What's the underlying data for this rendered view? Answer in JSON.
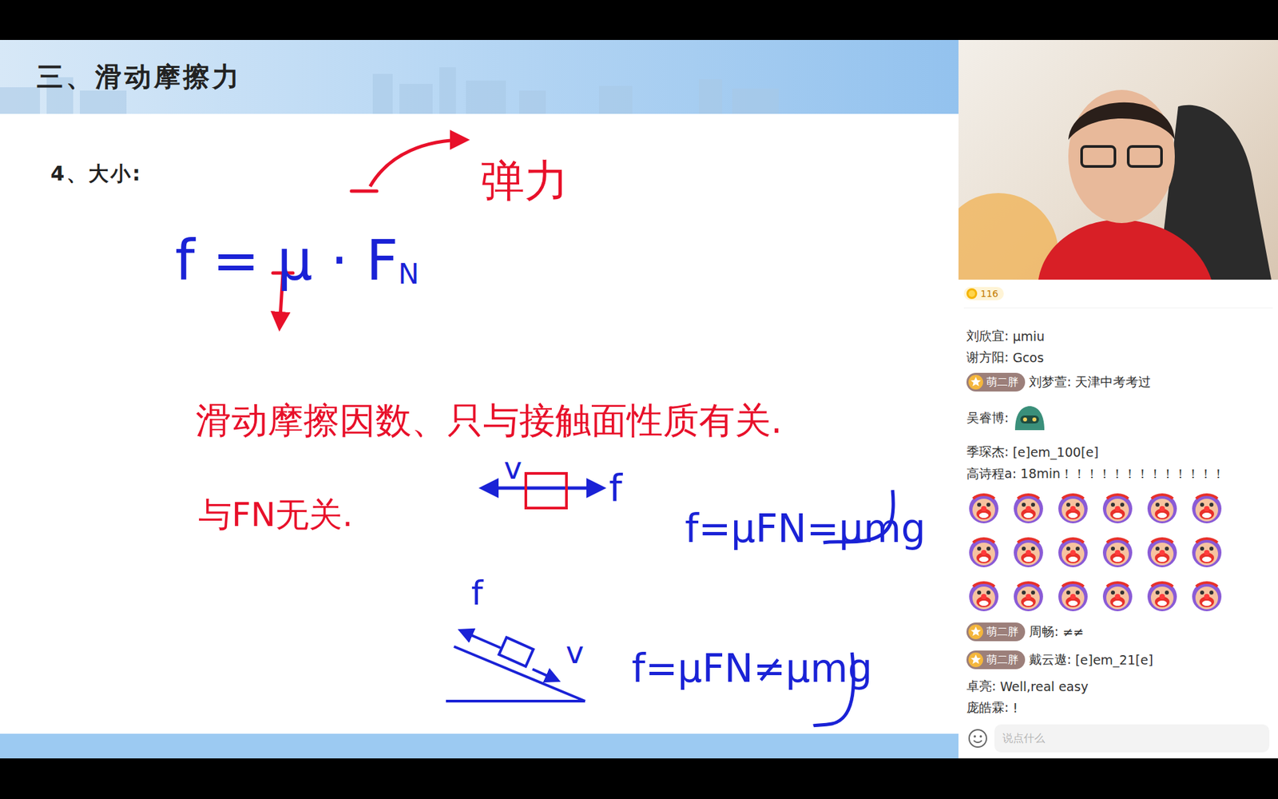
{
  "slide": {
    "title": "三、滑动摩擦力",
    "section": "4、大小:",
    "annotations": [
      {
        "text": "弹力",
        "color": "#e8102a"
      },
      {
        "text": "f = μ · F",
        "sub": "N",
        "color": "#1a22d6"
      },
      {
        "text": "滑动摩擦因数、只与接触面性质有关.",
        "color": "#e8102a"
      },
      {
        "text": "与FN无关.",
        "color": "#e8102a"
      },
      {
        "text": "v",
        "color": "#1a22d6"
      },
      {
        "text": "f",
        "color": "#1a22d6"
      },
      {
        "text": "f=μFN=μmg",
        "color": "#1a22d6"
      },
      {
        "text": "f",
        "color": "#1a22d6"
      },
      {
        "text": "v",
        "color": "#1a22d6"
      },
      {
        "text": "f=μFN≠μmg",
        "color": "#1a22d6"
      }
    ]
  },
  "coins": "116",
  "chat": {
    "messages": [
      {
        "kind": "text",
        "name": "刘欣宜:",
        "text": "μmiu"
      },
      {
        "kind": "text",
        "name": "谢方阳:",
        "text": "Gcos"
      },
      {
        "kind": "text",
        "badge": "萌二胖",
        "name": "刘梦萱:",
        "text": "天津中考考过"
      },
      {
        "kind": "sticker",
        "name": "吴睿博:"
      },
      {
        "kind": "text",
        "name": "季琛杰:",
        "text": "[e]em_100[e]"
      },
      {
        "kind": "text",
        "name": "高诗程a:",
        "text": "18min！！！！！！！！！！！！！"
      },
      {
        "kind": "sticker-grid",
        "count": 18
      },
      {
        "kind": "text",
        "badge": "萌二胖",
        "name": "周畅:",
        "text": "≠≠"
      },
      {
        "kind": "text",
        "badge": "萌二胖",
        "name": "戴云遨:",
        "text": "[e]em_21[e]"
      },
      {
        "kind": "text",
        "name": "卓亮:",
        "text": "Well,real easy"
      },
      {
        "kind": "text",
        "name": "庞皓霖:",
        "text": "!"
      }
    ]
  },
  "input": {
    "placeholder": "说点什么"
  }
}
